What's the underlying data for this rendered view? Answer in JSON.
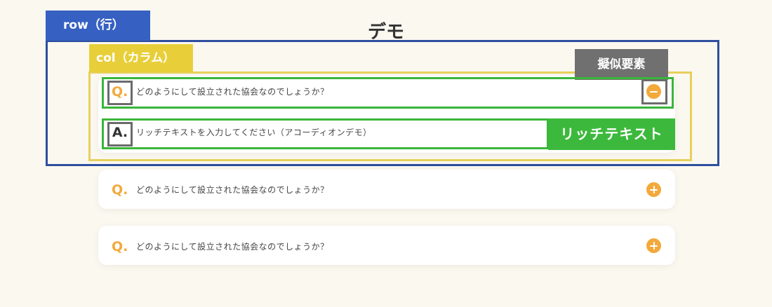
{
  "page": {
    "title": "デモ"
  },
  "annotations": {
    "row_label": "row（行）",
    "col_label": "col（カラム）",
    "pseudo_label": "擬似要素",
    "rich_text_label": "リッチテキスト"
  },
  "accordion": {
    "open_item": {
      "q_mark": "Q.",
      "question": "どのようにして設立された協会なのでしょうか？",
      "a_mark": "A.",
      "answer": "リッチテキストを入力してください（アコーディオンデモ）",
      "icon": "minus-icon"
    },
    "items": [
      {
        "q_mark": "Q.",
        "question": "どのようにして設立された協会なのでしょうか？",
        "icon": "plus-icon"
      },
      {
        "q_mark": "Q.",
        "question": "どのようにして設立された協会なのでしょうか？",
        "icon": "plus-icon"
      }
    ]
  },
  "colors": {
    "accent": "#f3a93a",
    "row_blue": "#3661c2",
    "col_yellow": "#e8cf3a",
    "rich_green": "#3cb93c",
    "pseudo_gray": "#707070"
  }
}
